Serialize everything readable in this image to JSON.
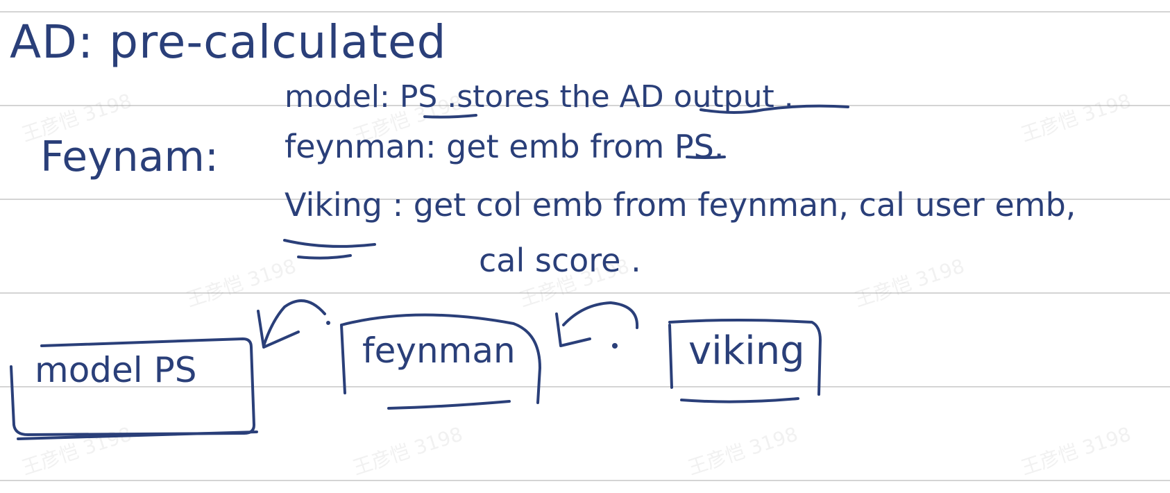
{
  "ink_color": "#2a3f79",
  "rule_color": "#d4d4d4",
  "notes": {
    "line1": "AD: pre-calculated",
    "line2": "model: PS .stores the AD output .",
    "line3_label": "Feynam:",
    "line3": "feynman: get emb from PS.",
    "line4": "Viking : get col emb from feynman, cal user emb,",
    "line5": "cal score ."
  },
  "diagram": {
    "box_ps": "model PS",
    "box_feynman": "feynman",
    "box_viking": "viking"
  },
  "watermark": "王彦恺 3198"
}
